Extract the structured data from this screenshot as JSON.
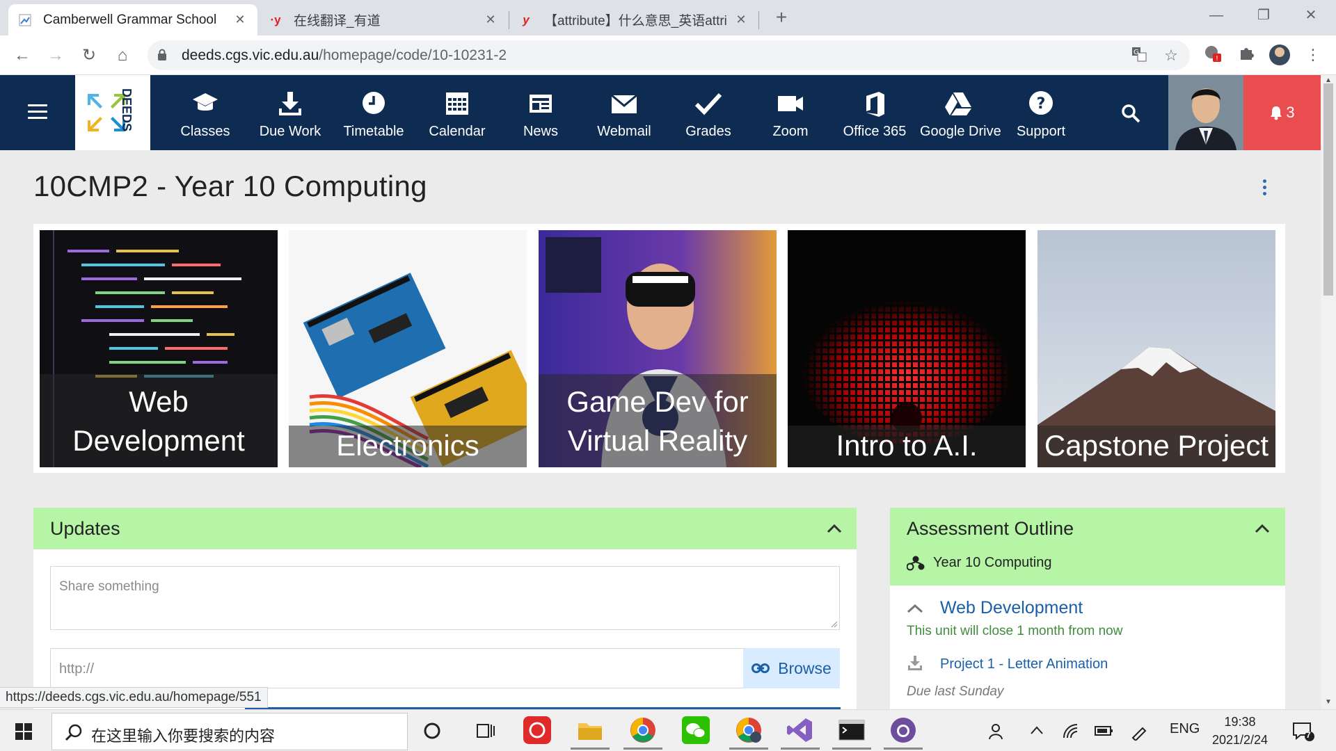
{
  "browser": {
    "tabs": [
      {
        "title": "Camberwell Grammar School",
        "active": true
      },
      {
        "title": "在线翻译_有道",
        "active": false
      },
      {
        "title": "【attribute】什么意思_英语attri",
        "active": false
      }
    ],
    "address": {
      "host": "deeds.cgs.vic.edu.au",
      "path": "/homepage/code/10-10231-2"
    }
  },
  "nav": {
    "items": [
      {
        "label": "Classes",
        "icon": "mortarboard-icon"
      },
      {
        "label": "Due Work",
        "icon": "download-icon"
      },
      {
        "label": "Timetable",
        "icon": "clock-icon"
      },
      {
        "label": "Calendar",
        "icon": "calendar-icon"
      },
      {
        "label": "News",
        "icon": "newspaper-icon"
      },
      {
        "label": "Webmail",
        "icon": "envelope-icon"
      },
      {
        "label": "Grades",
        "icon": "checkmark-icon"
      },
      {
        "label": "Zoom",
        "icon": "video-camera-icon"
      },
      {
        "label": "Office 365",
        "icon": "office-icon"
      },
      {
        "label": "Google Drive",
        "icon": "google-drive-icon"
      },
      {
        "label": "Support",
        "icon": "question-icon"
      }
    ],
    "logo_text": "DEEDS",
    "notification_count": "3"
  },
  "page": {
    "title": "10CMP2 - Year 10 Computing",
    "tiles": [
      {
        "caption": "Web Development"
      },
      {
        "caption": "Electronics"
      },
      {
        "caption": "Game Dev for Virtual Reality"
      },
      {
        "caption": "Intro to A.I."
      },
      {
        "caption": "Capstone Project"
      }
    ]
  },
  "updates": {
    "title": "Updates",
    "share_placeholder": "Share something",
    "url_placeholder": "http://",
    "browse_label": "Browse"
  },
  "assessment": {
    "title": "Assessment Outline",
    "subtitle": "Year 10 Computing",
    "unit_title": "Web Development",
    "unit_status": "This unit will close 1 month from now",
    "project": "Project 1 - Letter Animation",
    "due": "Due last Sunday"
  },
  "status_url": "https://deeds.cgs.vic.edu.au/homepage/551",
  "taskbar": {
    "search_placeholder": "在这里输入你要搜索的内容",
    "lang": "ENG",
    "time": "19:38",
    "date": "2021/2/24",
    "notif_count": "7"
  },
  "colors": {
    "nav_bg": "#0e2c52",
    "notif_bg": "#ea4d4f",
    "card_head": "#b6f5a6",
    "link": "#1b5fa8"
  }
}
